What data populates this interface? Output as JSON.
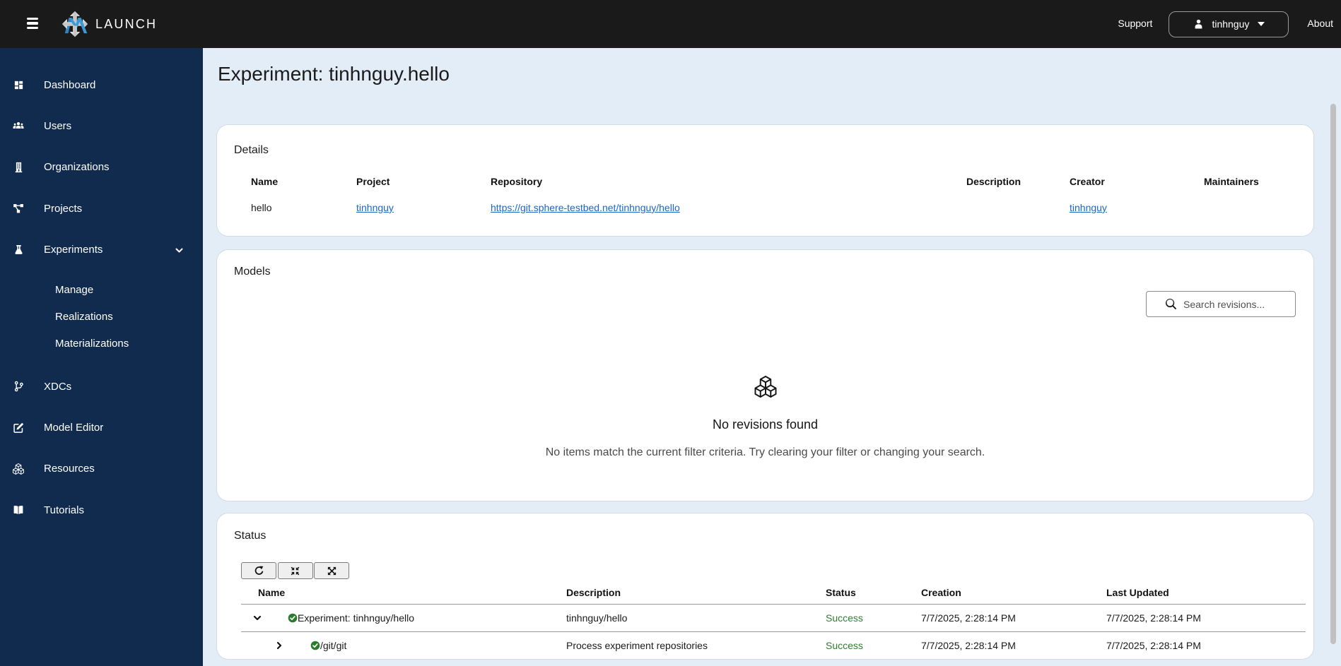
{
  "topbar": {
    "brand": "LAUNCH",
    "support_label": "Support",
    "user_name": "tinhnguy",
    "about_label": "About"
  },
  "sidebar": {
    "items": [
      {
        "label": "Dashboard",
        "icon": "dashboard-icon"
      },
      {
        "label": "Users",
        "icon": "users-icon"
      },
      {
        "label": "Organizations",
        "icon": "organizations-icon"
      },
      {
        "label": "Projects",
        "icon": "projects-icon"
      },
      {
        "label": "Experiments",
        "icon": "experiments-icon",
        "expanded": true
      },
      {
        "label": "XDCs",
        "icon": "xdcs-icon"
      },
      {
        "label": "Model Editor",
        "icon": "model-editor-icon"
      },
      {
        "label": "Resources",
        "icon": "resources-icon"
      },
      {
        "label": "Tutorials",
        "icon": "tutorials-icon"
      }
    ],
    "experiments_children": [
      {
        "label": "Manage"
      },
      {
        "label": "Realizations"
      },
      {
        "label": "Materializations"
      }
    ]
  },
  "page": {
    "title": "Experiment: tinhnguy.hello"
  },
  "details": {
    "heading": "Details",
    "columns": [
      "Name",
      "Project",
      "Repository",
      "Description",
      "Creator",
      "Maintainers"
    ],
    "row": {
      "name": "hello",
      "project": "tinhnguy",
      "repository": "https://git.sphere-testbed.net/tinhnguy/hello",
      "description": "",
      "creator": "tinhnguy",
      "maintainers": ""
    }
  },
  "models": {
    "heading": "Models",
    "search_placeholder": "Search revisions...",
    "empty_title": "No revisions found",
    "empty_message": "No items match the current filter criteria. Try clearing your filter or changing your search."
  },
  "status": {
    "heading": "Status",
    "columns": [
      "Name",
      "Description",
      "Status",
      "Creation",
      "Last Updated"
    ],
    "rows": [
      {
        "name": "Experiment: tinhnguy/hello",
        "description": "tinhnguy/hello",
        "status": "Success",
        "creation": "7/7/2025, 2:28:14 PM",
        "last_updated": "7/7/2025, 2:28:14 PM",
        "state": "expanded"
      },
      {
        "name": "/git/git",
        "description": "Process experiment repositories",
        "status": "Success",
        "creation": "7/7/2025, 2:28:14 PM",
        "last_updated": "7/7/2025, 2:28:14 PM",
        "state": "collapsed"
      }
    ]
  },
  "colors": {
    "topbar_bg": "#1a1a1a",
    "sidebar_bg": "#112b4e",
    "page_bg": "#e3edf7",
    "link": "#1b66c9",
    "success": "#2e7d32",
    "logo_blue": "#3b99d8"
  }
}
